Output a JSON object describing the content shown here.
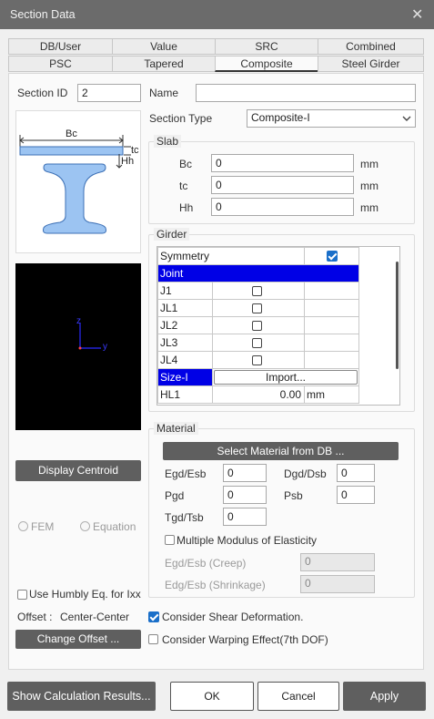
{
  "window": {
    "title": "Section Data"
  },
  "tabs_row1": [
    "DB/User",
    "Value",
    "SRC",
    "Combined"
  ],
  "tabs_row2": [
    "PSC",
    "Tapered",
    "Composite",
    "Steel Girder"
  ],
  "section": {
    "id_label": "Section ID",
    "id_value": "2",
    "name_label": "Name",
    "name_value": "",
    "type_label": "Section Type",
    "type_value": "Composite-I"
  },
  "diagram": {
    "bc": "Bc",
    "tc": "tc",
    "hh": "Hh",
    "axis_z": "z",
    "axis_y": "y"
  },
  "slab": {
    "title": "Slab",
    "rows": [
      {
        "label": "Bc",
        "value": "0",
        "unit": "mm"
      },
      {
        "label": "tc",
        "value": "0",
        "unit": "mm"
      },
      {
        "label": "Hh",
        "value": "0",
        "unit": "mm"
      }
    ]
  },
  "girder": {
    "title": "Girder",
    "symmetry_label": "Symmetry",
    "symmetry_checked": true,
    "joint_label": "Joint",
    "joints": [
      "J1",
      "JL1",
      "JL2",
      "JL3",
      "JL4"
    ],
    "size_label": "Size-I",
    "import_label": "Import...",
    "hl1_label": "HL1",
    "hl1_value": "0.00",
    "hl1_unit": "mm"
  },
  "left": {
    "display_centroid": "Display Centroid",
    "fem": "FEM",
    "equation": "Equation",
    "humbly": "Use Humbly Eq. for Ixx",
    "offset_label": "Offset :",
    "offset_value": "Center-Center",
    "change_offset": "Change Offset ..."
  },
  "material": {
    "title": "Material",
    "select_button": "Select Material from DB ...",
    "egd_label": "Egd/Esb",
    "egd_value": "0",
    "dgd_label": "Dgd/Dsb",
    "dgd_value": "0",
    "pgd_label": "Pgd",
    "pgd_value": "0",
    "psb_label": "Psb",
    "psb_value": "0",
    "tgd_label": "Tgd/Tsb",
    "tgd_value": "0",
    "multiple_label": "Multiple Modulus of Elasticity",
    "creep_label": "Egd/Esb (Creep)",
    "creep_value": "0",
    "shrink_label": "Edg/Esb (Shrinkage)",
    "shrink_value": "0"
  },
  "options": {
    "shear_label": "Consider Shear Deformation.",
    "shear_checked": true,
    "warping_label": "Consider Warping Effect(7th DOF)"
  },
  "footer": {
    "show_calc": "Show Calculation Results...",
    "ok": "OK",
    "cancel": "Cancel",
    "apply": "Apply"
  },
  "colors": {
    "accent": "#0000e6",
    "titlebar": "#6b6b6b",
    "dark_button": "#5f5f5f",
    "section_fill": "#9cc4f2",
    "check_blue": "#1a6fc9"
  }
}
